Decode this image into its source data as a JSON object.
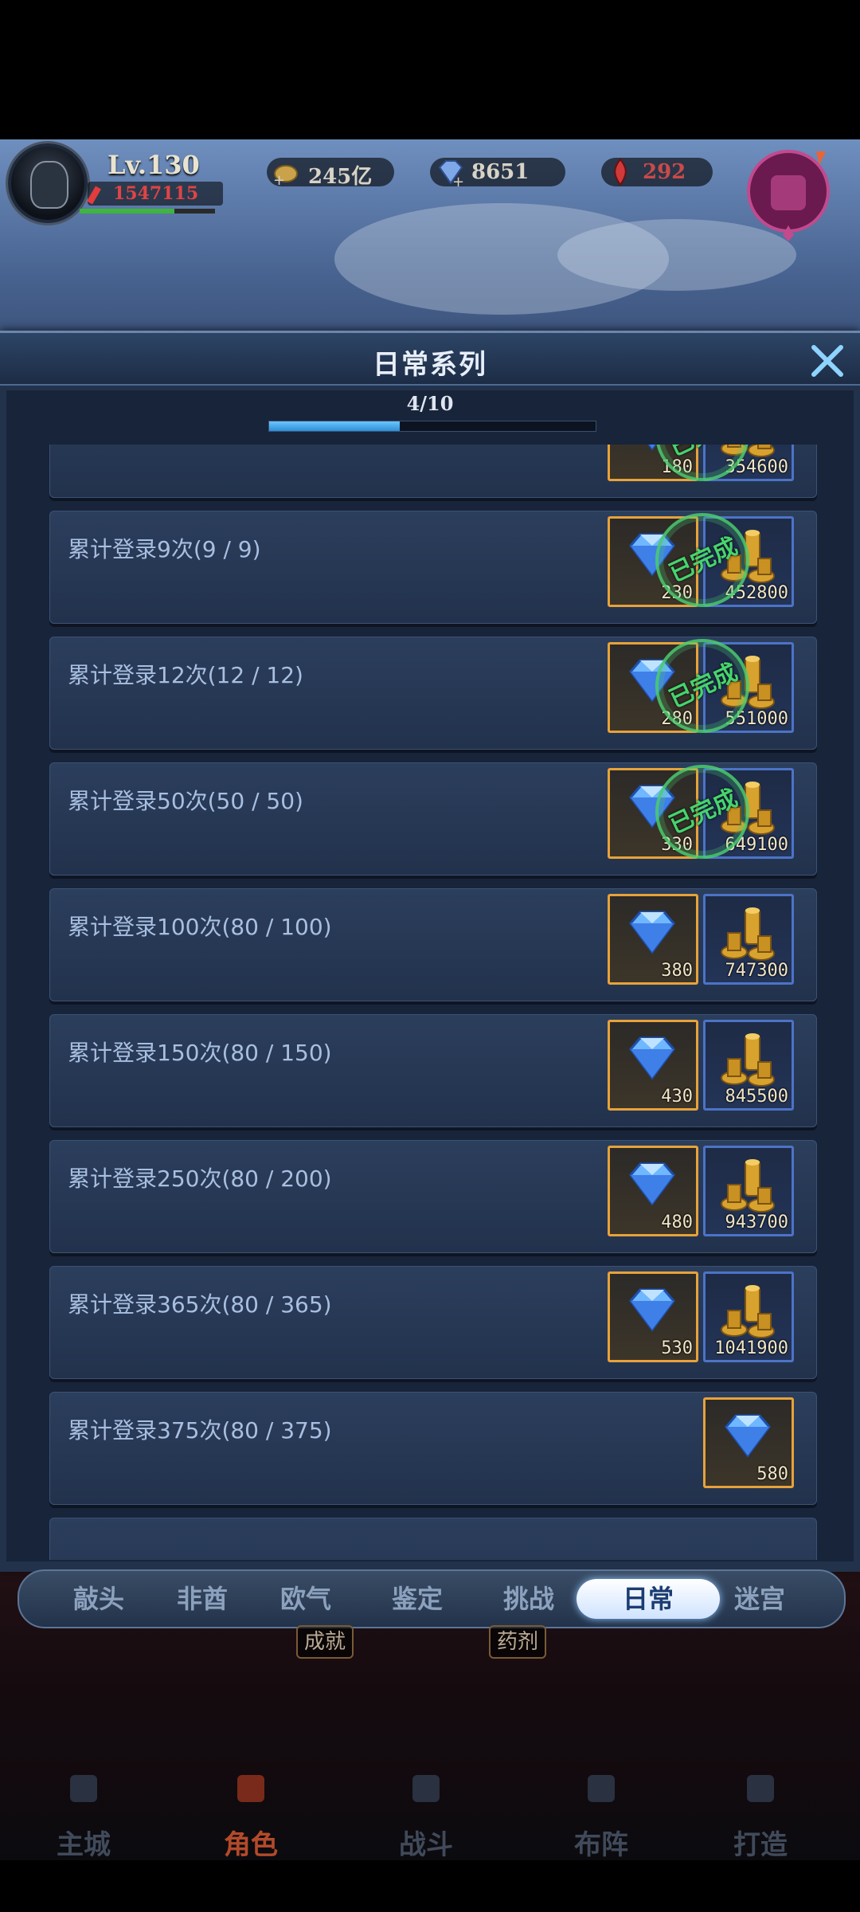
{
  "player": {
    "level": "Lv.130",
    "power": "1547115",
    "hp_fraction": 0.7
  },
  "resources": [
    {
      "icon": "gold-coin-icon",
      "value": "245亿"
    },
    {
      "icon": "diamond-icon",
      "value": "8651"
    },
    {
      "icon": "red-gem-icon",
      "value": "292"
    }
  ],
  "panel": {
    "title": "日常系列",
    "progress_text": "4/10",
    "progress_fraction": 0.4
  },
  "items": [
    {
      "label": "",
      "rewards": [
        {
          "type": "diamond",
          "amount": "180"
        },
        {
          "type": "gold",
          "amount": "354600"
        }
      ],
      "completed": true
    },
    {
      "label": "累计登录9次(9 / 9)",
      "rewards": [
        {
          "type": "diamond",
          "amount": "230"
        },
        {
          "type": "gold",
          "amount": "452800"
        }
      ],
      "completed": true
    },
    {
      "label": "累计登录12次(12 / 12)",
      "rewards": [
        {
          "type": "diamond",
          "amount": "280"
        },
        {
          "type": "gold",
          "amount": "551000"
        }
      ],
      "completed": true
    },
    {
      "label": "累计登录50次(50 / 50)",
      "rewards": [
        {
          "type": "diamond",
          "amount": "330"
        },
        {
          "type": "gold",
          "amount": "649100"
        }
      ],
      "completed": true
    },
    {
      "label": "累计登录100次(80 / 100)",
      "rewards": [
        {
          "type": "diamond",
          "amount": "380"
        },
        {
          "type": "gold",
          "amount": "747300"
        }
      ],
      "completed": false
    },
    {
      "label": "累计登录150次(80 / 150)",
      "rewards": [
        {
          "type": "diamond",
          "amount": "430"
        },
        {
          "type": "gold",
          "amount": "845500"
        }
      ],
      "completed": false
    },
    {
      "label": "累计登录250次(80 / 200)",
      "rewards": [
        {
          "type": "diamond",
          "amount": "480"
        },
        {
          "type": "gold",
          "amount": "943700"
        }
      ],
      "completed": false
    },
    {
      "label": "累计登录365次(80 / 365)",
      "rewards": [
        {
          "type": "diamond",
          "amount": "530"
        },
        {
          "type": "gold",
          "amount": "1041900"
        }
      ],
      "completed": false
    },
    {
      "label": "累计登录375次(80 / 375)",
      "rewards": [
        {
          "type": "diamond",
          "amount": "580"
        }
      ],
      "completed": false
    }
  ],
  "stamp_text": "已完成",
  "tabs": [
    "敲头",
    "非酋",
    "欧气",
    "鉴定",
    "挑战",
    "日常",
    "迷宫"
  ],
  "active_tab": "日常",
  "subtabs": [
    "成就",
    "药剂"
  ],
  "nav": [
    {
      "label": "主城",
      "icon": "castle-icon"
    },
    {
      "label": "角色",
      "icon": "helmet-icon",
      "active": true
    },
    {
      "label": "战斗",
      "icon": "crossed-swords-icon"
    },
    {
      "label": "布阵",
      "icon": "formation-icon"
    },
    {
      "label": "打造",
      "icon": "anvil-icon"
    }
  ]
}
